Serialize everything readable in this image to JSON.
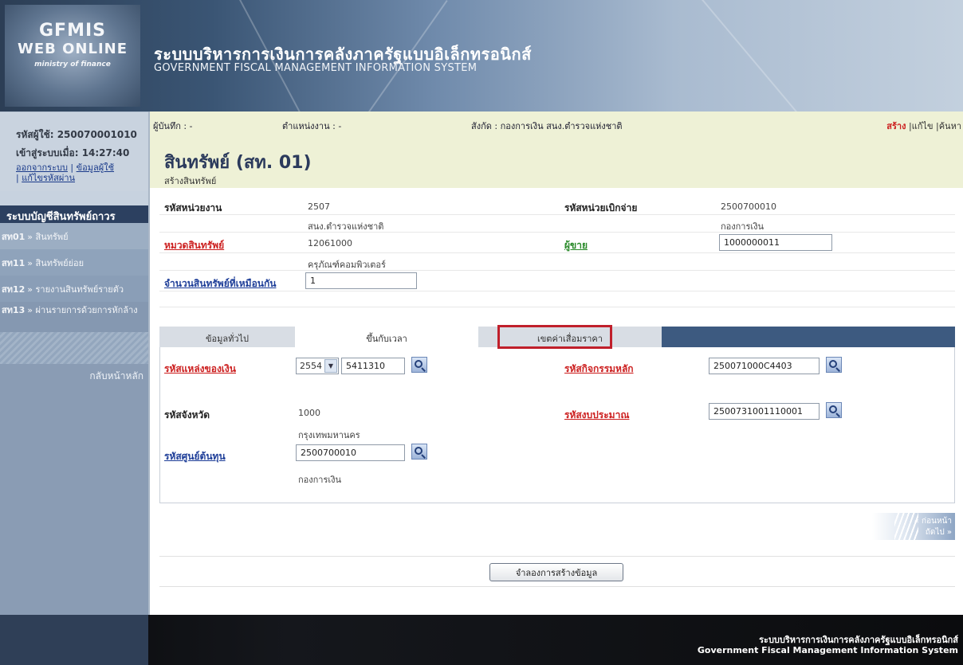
{
  "header": {
    "logo_line1": "GFMIS",
    "logo_line2": "WEB ONLINE",
    "logo_line3": "ministry of finance",
    "title_th": "ระบบบริหารการเงินการคลังภาครัฐแบบอิเล็กทรอนิกส์",
    "title_en": "GOVERNMENT FISCAL MANAGEMENT INFORMATION SYSTEM"
  },
  "user": {
    "user_id": "รหัสผู้ใช้: 250070001010",
    "login_time": "เข้าสู่ระบบเมื่อ: 14:27:40",
    "logout": "ออกจากระบบ",
    "user_info": "ข้อมูลผู้ใช้",
    "change_password": "แก้ไขรหัสผ่าน"
  },
  "sidebar": {
    "title": "ระบบบัญชีสินทรัพย์ถาวร",
    "items": [
      {
        "code": "สท01",
        "label": "» สินทรัพย์"
      },
      {
        "code": "สท11",
        "label": "» สินทรัพย์ย่อย"
      },
      {
        "code": "สท12",
        "label": "» รายงานสินทรัพย์รายตัว"
      },
      {
        "code": "สท13",
        "label": "» ผ่านรายการด้วยการหักล้าง"
      }
    ],
    "home": "กลับหน้าหลัก"
  },
  "topbar": {
    "recorder": "ผู้บันทึก : -",
    "position": "ตำแหน่งงาน : -",
    "affiliation": "สังกัด : กองการเงิน สนง.ตำรวจแห่งชาติ",
    "create": "สร้าง",
    "edit": "แก้ไข",
    "search": "ค้นหา"
  },
  "page": {
    "title": "สินทรัพย์ (สท. 01)",
    "subtitle": "สร้างสินทรัพย์"
  },
  "form": {
    "agency_label": "รหัสหน่วยงาน",
    "agency_code": "2507",
    "agency_name": "สนง.ตำรวจแห่งชาติ",
    "disb_label": "รหัสหน่วยเบิกจ่าย",
    "disb_code": "2500700010",
    "disb_name": "กองการเงิน",
    "category_label": "หมวดสินทรัพย์",
    "category_code": "12061000",
    "category_name": "ครุภัณฑ์คอมพิวเตอร์",
    "vendor_label": "ผู้ขาย",
    "vendor_value": "1000000011",
    "similar_label": "จำนวนสินทรัพย์ที่เหมือนกัน",
    "similar_value": "1"
  },
  "tabs": {
    "general": "ข้อมูลทั่วไป",
    "time": "ขึ้นกับเวลา",
    "depreciation": "เขตค่าเสื่อมราคา"
  },
  "time_tab": {
    "fund_label": "รหัสแหล่งของเงิน",
    "fund_year": "2554",
    "fund_code": "5411310",
    "activity_label": "รหัสกิจกรรมหลัก",
    "activity_value": "250071000C4403",
    "province_label": "รหัสจังหวัด",
    "province_code": "1000",
    "province_name": "กรุงเทพมหานคร",
    "budget_label": "รหัสงบประมาณ",
    "budget_value": "2500731001110001",
    "cost_center_label": "รหัสศูนย์ต้นทุน",
    "cost_center_value": "2500700010",
    "cost_center_name": "กองการเงิน"
  },
  "nav": {
    "prev": "« ก่อนหน้า",
    "next": "ถัดไป »"
  },
  "actions": {
    "simulate": "จำลองการสร้างข้อมูล"
  },
  "footer": {
    "th": "ระบบบริหารการเงินการคลังภาครัฐแบบอิเล็กทรอนิกส์",
    "en": "Government Fiscal Management Information System"
  },
  "colors": {
    "header_dark": "#2c3e55",
    "accent_red": "#cc1f1f",
    "tab_bar": "#3d5a80",
    "title_bg": "#eef1d6"
  },
  "icons": {
    "search": "magnifier-icon",
    "dropdown": "chevron-down-icon"
  }
}
